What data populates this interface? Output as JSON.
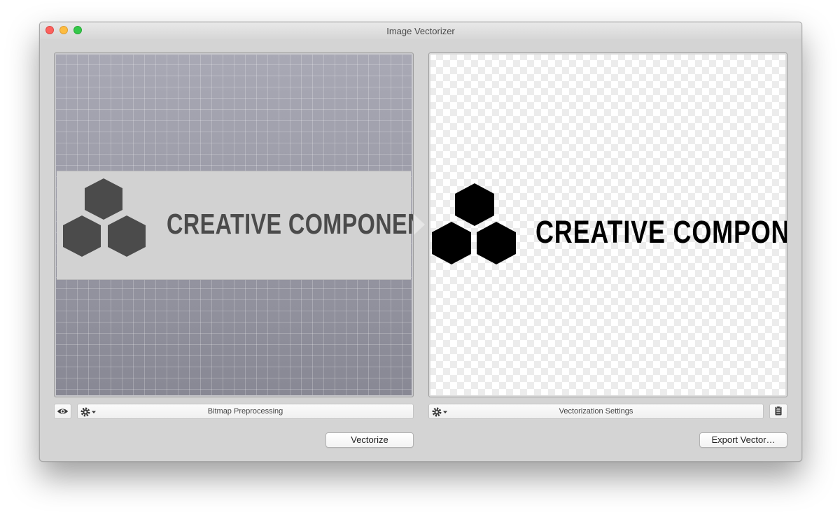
{
  "window": {
    "title": "Image Vectorizer"
  },
  "left_panel": {
    "bitmap_logo_text": "CREATIVE COMPONENT",
    "toolbar_label": "Bitmap Preprocessing",
    "eye_icon": "eye-icon",
    "gear_icon": "gear-icon"
  },
  "right_panel": {
    "vector_logo_text": "CREATIVE COMPONENT",
    "toolbar_label": "Vectorization Settings",
    "gear_icon": "gear-icon",
    "clipboard_icon": "clipboard-icon"
  },
  "buttons": {
    "vectorize_label": "Vectorize",
    "export_label": "Export Vector…"
  },
  "colors": {
    "close": "#fc615d",
    "minimize": "#fdbc40",
    "maximize": "#34c84a"
  }
}
